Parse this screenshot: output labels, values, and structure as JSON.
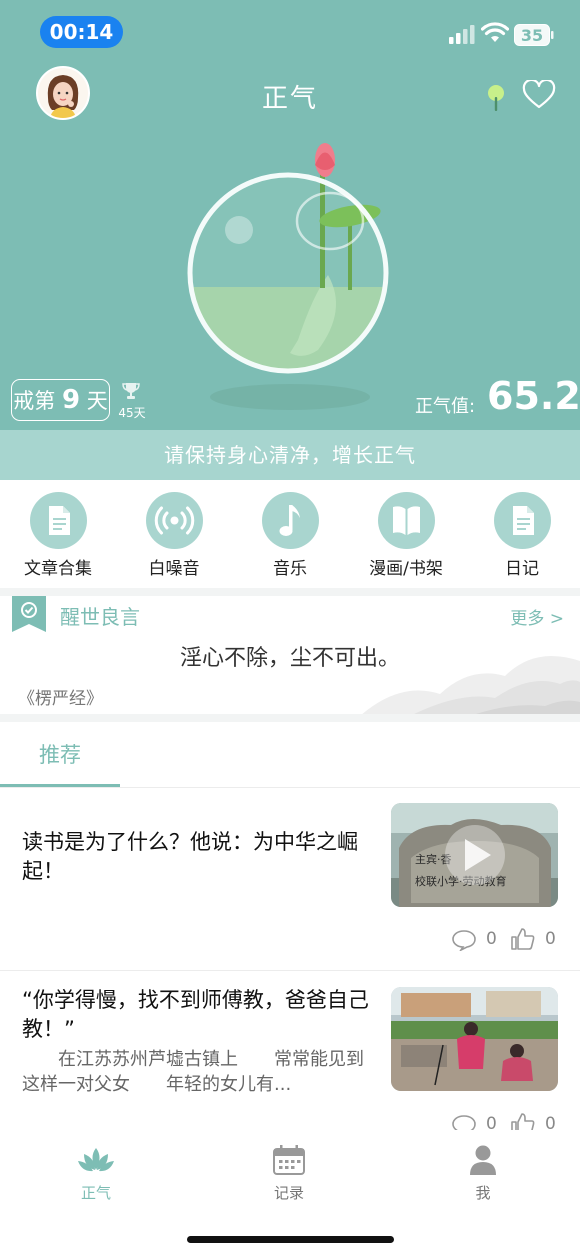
{
  "status_bar": {
    "time": "00:14",
    "battery": "35"
  },
  "header": {
    "title": "正气"
  },
  "hero": {
    "streak_prefix": "戒第",
    "streak_days": "9",
    "streak_suffix": "天",
    "record_days": "45天",
    "score_label": "正气值:",
    "score_value": "65.2"
  },
  "motto": "请保持身心清净，增长正气",
  "shortcuts": [
    {
      "label": "文章合集",
      "icon": "document-icon"
    },
    {
      "label": "白噪音",
      "icon": "broadcast-icon"
    },
    {
      "label": "音乐",
      "icon": "music-note-icon"
    },
    {
      "label": "漫画/书架",
      "icon": "book-icon"
    },
    {
      "label": "日记",
      "icon": "diary-icon"
    }
  ],
  "quote": {
    "heading": "醒世良言",
    "more": "更多 >",
    "text": "淫心不除，尘不可出。",
    "source": "《楞严经》"
  },
  "tabs": [
    {
      "label": "推荐"
    }
  ],
  "articles": [
    {
      "title": "读书是为了什么？他说：为中华之崛起！",
      "comments": "0",
      "likes": "0"
    },
    {
      "title": "“你学得慢，找不到师傅教，爸爸自己教！”",
      "summary": "　　在江苏苏州芦墟古镇上　　常常能见到这样一对父女　　年轻的女儿有...",
      "comments": "0",
      "likes": "0"
    }
  ],
  "bottom_nav": [
    {
      "label": "正气",
      "icon": "lotus-icon",
      "active": true
    },
    {
      "label": "记录",
      "icon": "calendar-icon",
      "active": false
    },
    {
      "label": "我",
      "icon": "person-icon",
      "active": false
    }
  ],
  "colors": {
    "accent": "#7dbdb4",
    "accent_light": "#a9d5cf",
    "status_pill": "#1a82f0"
  }
}
